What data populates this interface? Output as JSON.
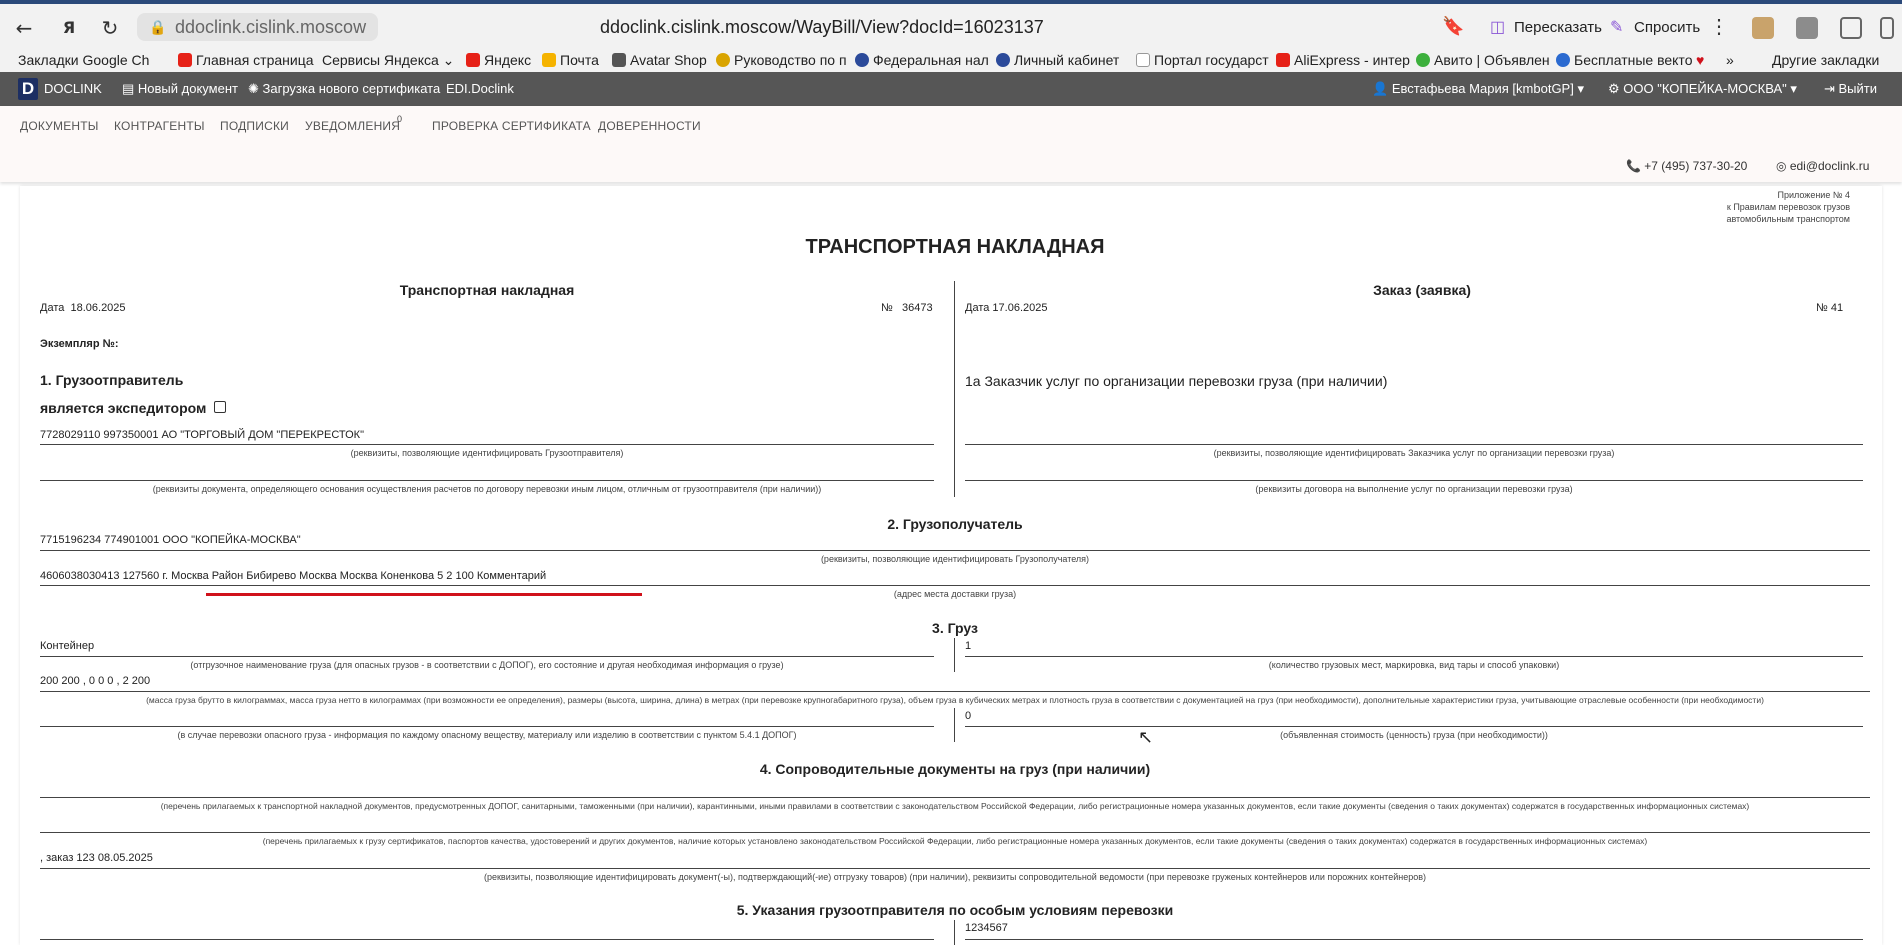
{
  "browser": {
    "url_short": "ddoclink.cislink.moscow",
    "url_full": "ddoclink.cislink.moscow/WayBill/View?docId=16023137",
    "ai_buttons": [
      "Пересказать",
      "Спросить"
    ],
    "bookmarks": [
      "Закладки Google Ch",
      "Главная страница",
      "Сервисы Яндекса",
      "Яндекс",
      "Почта",
      "Avatar Shop",
      "Руководство по п",
      "Федеральная нал",
      "Личный кабинет",
      "Портал государст",
      "AliExpress - интер",
      "Авито | Объявлен",
      "Бесплатные векто",
      "Другие закладки"
    ]
  },
  "app": {
    "brand": "DOCLINK",
    "header_items": [
      "Новый документ",
      "Загрузка нового сертификата",
      "EDI.Doclink"
    ],
    "user": "Евстафьева Мария [kmbotGP]",
    "org": "ООО \"КОПЕЙКА-МОСКВА\"",
    "logout": "Выйти"
  },
  "tabs": [
    "ДОКУМЕНТЫ",
    "КОНТРАГЕНТЫ",
    "ПОДПИСКИ",
    "УВЕДОМЛЕНИЯ",
    "ПРОВЕРКА СЕРТИФИКАТА",
    "ДОВЕРЕННОСТИ"
  ],
  "notifications_count": "0",
  "contacts": {
    "phone": "+7 (495) 737-30-20",
    "email": "edi@doclink.ru"
  },
  "doc": {
    "appendix": [
      "Приложение № 4",
      "к Правилам перевозок грузов",
      "автомобильным транспортом"
    ],
    "title": "ТРАНСПОРТНАЯ НАКЛАДНАЯ",
    "left_header": "Транспортная накладная",
    "date_label": "Дата",
    "date_value": "18.06.2025",
    "num_label": "№",
    "num_value": "36473",
    "right_header": "Заказ (заявка)",
    "order_date": "Дата 17.06.2025",
    "order_num": "№ 41",
    "copy_label": "Экземпляр №:",
    "s1_title": "1. Грузоотправитель",
    "s1_forwarder": "является экспедитором",
    "s1_shipper": "7728029110 997350001 АО \"ТОРГОВЫЙ ДОМ \"ПЕРЕКРЕСТОК\"",
    "s1_cap1": "(реквизиты, позволяющие идентифицировать Грузоотправителя)",
    "s1_cap2": "(реквизиты документа, определяющего основания осуществления расчетов по договору перевозки иным лицом, отличным от грузоотправителя (при наличии))",
    "s1a_title": "1а Заказчик услуг по организации перевозки груза (при наличии)",
    "s1a_cap1": "(реквизиты, позволяющие идентифицировать Заказчика услуг по организации перевозки груза)",
    "s1a_cap2": "(реквизиты договора на выполнение услуг по организации перевозки груза)",
    "s2_title": "2. Грузополучатель",
    "s2_consignee": "7715196234 774901001 ООО \"КОПЕЙКА-МОСКВА\"",
    "s2_cap1": "(реквизиты, позволяющие идентифицировать Грузополучателя)",
    "s2_address": "4606038030413 127560 г. Москва Район Бибирево Москва Москва Коненкова 5 2 100 Комментарий",
    "s2_cap2": "(адрес места доставки груза)",
    "s3_title": "3. Груз",
    "s3_cargo": "Контейнер",
    "s3_cap1": "(отгрузочное наименование груза (для опасных грузов - в соответствии с ДОПОГ), его состояние и другая необходимая информация о грузе)",
    "s3_places": "1",
    "s3_cap_places": "(количество грузовых мест, маркировка, вид тары и способ упаковки)",
    "s3_mass": "200 200 , 0 0 0 , 2 200",
    "s3_cap2": "(масса груза брутто в килограммах, масса груза нетто в килограммах (при возможности ее определения), размеры (высота, ширина, длина) в метрах (при перевозке крупногабаритного груза), объем груза в кубических метрах и плотность груза в соответствии с документацией на груз (при необходимости), дополнительные характеристики груза, учитывающие отраслевые особенности (при необходимости)",
    "s3_cap3": "(в случае перевозки опасного груза - информация по каждому опасному веществу, материалу или изделию в соответствии с пунктом 5.4.1 ДОПОГ)",
    "s3_value": "0",
    "s3_cap_value": "(объявленная стоимость (ценность) груза (при необходимости))",
    "s4_title": "4. Сопроводительные документы на груз (при наличии)",
    "s4_cap1": "(перечень прилагаемых к транспортной накладной документов, предусмотренных ДОПОГ, санитарными, таможенными (при наличии), карантинными, иными правилами в соответствии с законодательством Российской Федерации, либо регистрационные номера указанных документов, если такие документы (сведения о таких документах) содержатся в государственных информационных системах)",
    "s4_cap2": "(перечень прилагаемых к грузу сертификатов, паспортов качества, удостоверений и других документов, наличие которых установлено законодательством Российской Федерации, либо регистрационные номера указанных документов, если такие документы (сведения о таких документах) содержатся в государственных информационных системах)",
    "s4_order": ", заказ 123 08.05.2025",
    "s4_cap3": "(реквизиты, позволяющие идентифицировать документ(-ы), подтверждающий(-ие) отгрузку товаров) (при наличии), реквизиты сопроводительной ведомости (при перевозке груженых контейнеров или порожних контейнеров)",
    "s5_title": "5. Указания грузоотправителя по особым условиям перевозки",
    "s5_value": "1234567"
  },
  "colors": {
    "app_header": "#565656",
    "subnav": "#fdf9f8",
    "underline": "#d0111b",
    "logo": "#1d2f63"
  }
}
